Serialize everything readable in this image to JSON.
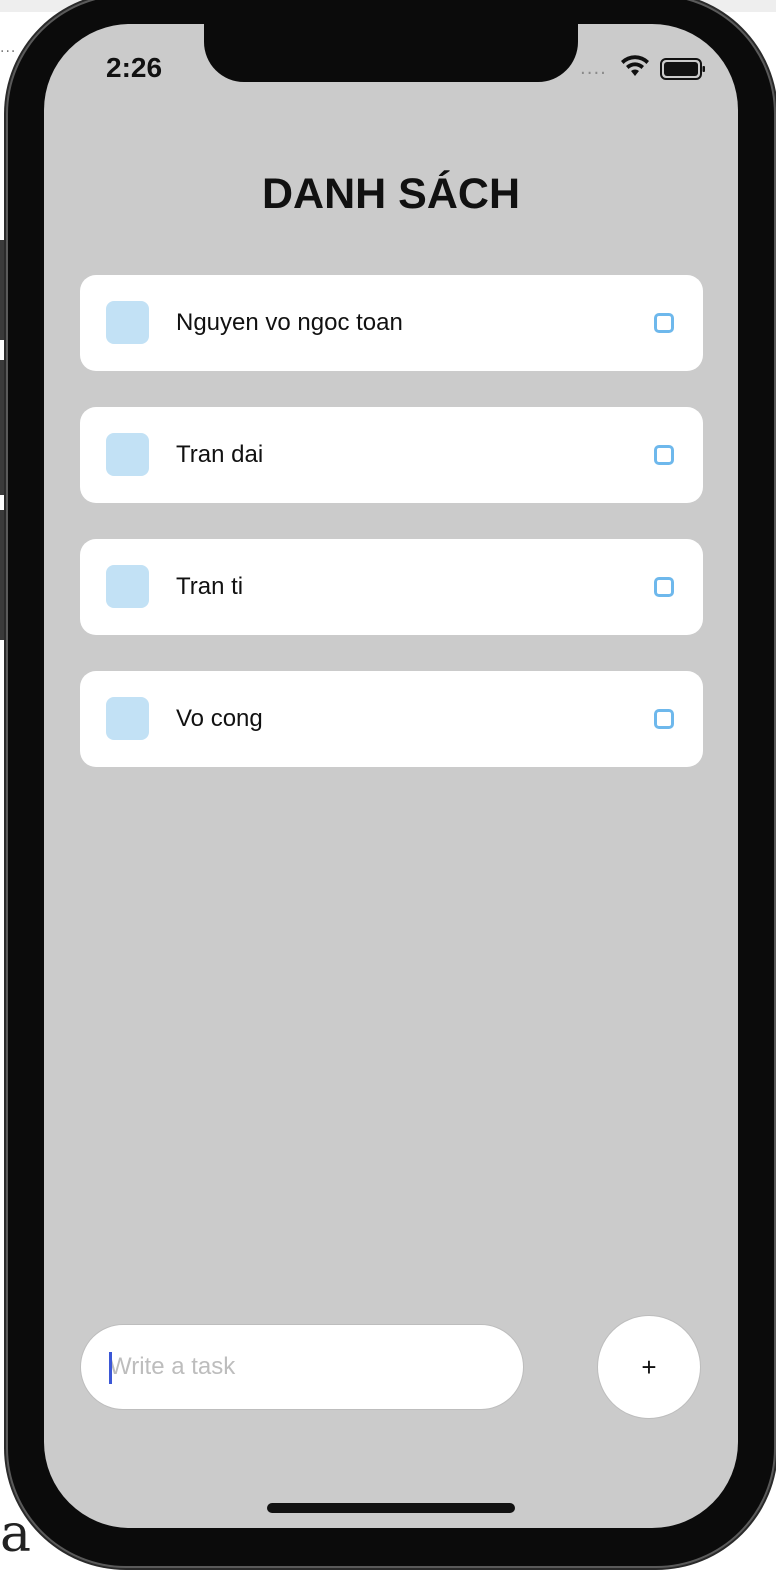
{
  "status_bar": {
    "time": "2:26",
    "signal_dots": "....",
    "wifi_icon": "wifi-icon",
    "battery_icon": "battery-icon"
  },
  "header": {
    "title": "DANH SÁCH"
  },
  "tasks": [
    {
      "label": "Nguyen vo ngoc toan"
    },
    {
      "label": "Tran dai"
    },
    {
      "label": "Tran ti"
    },
    {
      "label": "Vo cong"
    }
  ],
  "composer": {
    "input_value": "",
    "input_placeholder": "Write a task",
    "add_label": "+"
  },
  "colors": {
    "screen_bg": "#cbcbcb",
    "card_bg": "#ffffff",
    "square_fill": "#c2e1f5",
    "circle_stroke": "#6eb8ec",
    "caret": "#3b57d6"
  },
  "background_page": {
    "dots": "...",
    "bottom_text": "a"
  }
}
